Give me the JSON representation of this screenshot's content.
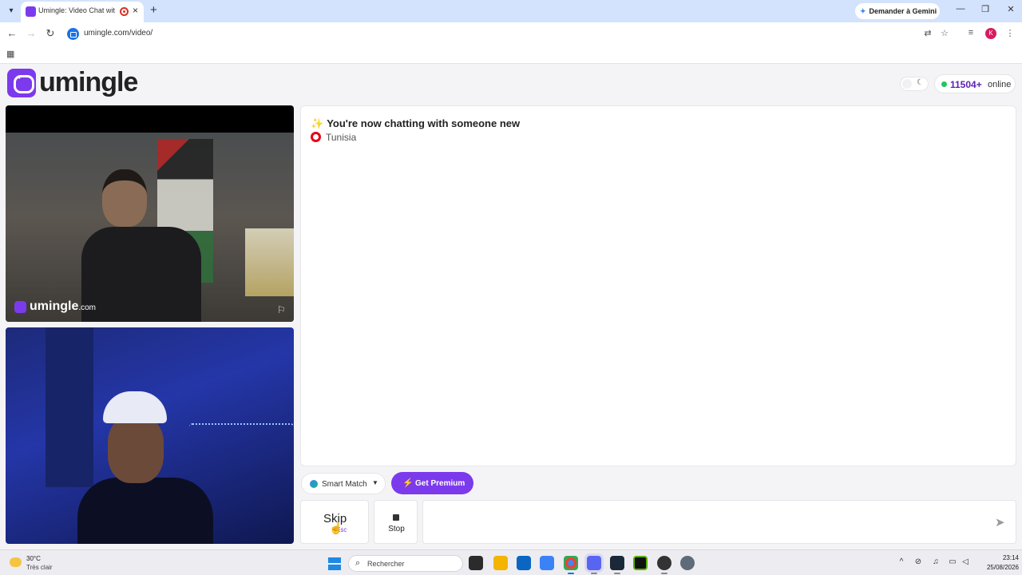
{
  "browser": {
    "tab_title": "Umingle: Video Chat with Strangers",
    "tab_close": "×",
    "new_tab": "+",
    "gemini_label": "Demander à Gemini",
    "url": "umingle.com/video/",
    "profile_initial": "K",
    "window_controls": {
      "minimize": "—",
      "maximize": "❐",
      "close": "✕"
    }
  },
  "header": {
    "logo_text": "umingle",
    "online_count": "11504+",
    "online_label": "online"
  },
  "remote_video": {
    "watermark_name": "umingle",
    "watermark_suffix": ".com"
  },
  "chat": {
    "status_message": "You're now chatting with someone new",
    "partner_country": "Tunisia"
  },
  "controls": {
    "smart_match_label": "Smart Match",
    "premium_label": "Get Premium",
    "skip_label": "Skip",
    "skip_hint": "Esc",
    "stop_label": "Stop",
    "message_placeholder": ""
  },
  "taskbar": {
    "weather_temp": "30°C",
    "weather_desc": "Très clair",
    "search_placeholder": "Rechercher",
    "time": "23:14",
    "date": "25/08/2026"
  },
  "colors": {
    "brand_purple": "#7c3aed",
    "online_green": "#22c55e",
    "online_count": "#5b21b6"
  }
}
